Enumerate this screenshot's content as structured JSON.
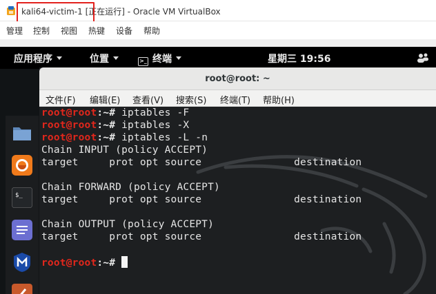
{
  "window": {
    "title": "kali64-victim-1 [正在运行] - Oracle VM VirtualBox",
    "highlight_color": "#e2201c"
  },
  "vbox_menu": {
    "items": [
      "管理",
      "控制",
      "视图",
      "热键",
      "设备",
      "帮助"
    ]
  },
  "gnome_topbar": {
    "applications": "应用程序",
    "places": "位置",
    "terminal": "终端",
    "terminal_icon_glyph": ">_",
    "clock": "星期三 19:56",
    "right_icon": "network-users-icon"
  },
  "dock": {
    "apps": [
      "files-icon",
      "firefox-icon",
      "terminal-icon",
      "text-editor-icon",
      "metasploit-icon",
      "burp-icon"
    ]
  },
  "terminal": {
    "title": "root@root: ~",
    "menu": [
      "文件(F)",
      "编辑(E)",
      "查看(V)",
      "搜索(S)",
      "终端(T)",
      "帮助(H)"
    ],
    "prompt_user": "root@root",
    "prompt_path": ":~#",
    "lines": [
      {
        "type": "cmd",
        "text": " iptables -F"
      },
      {
        "type": "cmd",
        "text": " iptables -X"
      },
      {
        "type": "cmd",
        "text": " iptables -L -n"
      },
      {
        "type": "out",
        "text": "Chain INPUT (policy ACCEPT)"
      },
      {
        "type": "out",
        "text": "target     prot opt source               destination"
      },
      {
        "type": "out",
        "text": ""
      },
      {
        "type": "out",
        "text": "Chain FORWARD (policy ACCEPT)"
      },
      {
        "type": "out",
        "text": "target     prot opt source               destination"
      },
      {
        "type": "out",
        "text": ""
      },
      {
        "type": "out",
        "text": "Chain OUTPUT (policy ACCEPT)"
      },
      {
        "type": "out",
        "text": "target     prot opt source               destination"
      },
      {
        "type": "out",
        "text": ""
      },
      {
        "type": "cursor",
        "text": " "
      }
    ]
  }
}
